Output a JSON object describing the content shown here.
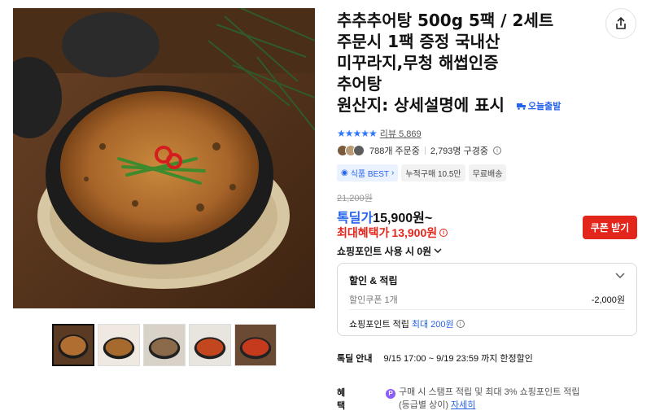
{
  "product": {
    "title_lines": [
      "추추추어탕 500g 5팩 / 2세트",
      "주문시 1팩 증정 국내산",
      "미꾸라지,무청 해썹인증",
      "추어탕",
      "원산지: 상세설명에 표시"
    ],
    "delivery_badge": "오늘출발"
  },
  "rating": {
    "stars": "★★★★★",
    "review_text": "리뷰 5,869"
  },
  "orders": {
    "order_count": "788개 주문중",
    "subscriber_count": "2,793명 구경중"
  },
  "tags": [
    "식품 BEST",
    "누적구매 10.5만",
    "무료배송"
  ],
  "price": {
    "original": "21,200원",
    "sale_label": "톡딜가",
    "sale_value": "15,900원~",
    "max_label": "최대혜택가",
    "max_value": "13,900원"
  },
  "coupon_button": "쿠폰 받기",
  "point_use": "쇼핑포인트 사용 시 0원",
  "discount_box": {
    "title": "할인 & 적립",
    "coupon_label": "할인쿠폰 1개",
    "coupon_amount": "-2,000원",
    "points_label": "쇼핑포인트 적립",
    "points_max": "최대",
    "points_value": "200원"
  },
  "deal": {
    "label": "톡딜 안내",
    "text": "9/15 17:00 ~ 9/19 23:59 까지 한정할인"
  },
  "benefit": {
    "label": "혜택",
    "line1": "구매 시 스탬프 적립 및 최대 3% 쇼핑포인트 적립",
    "line2": "(등급별 상이)",
    "link": "자세히"
  },
  "colors": {
    "accent_blue": "#2563eb",
    "accent_red": "#e2261b"
  }
}
